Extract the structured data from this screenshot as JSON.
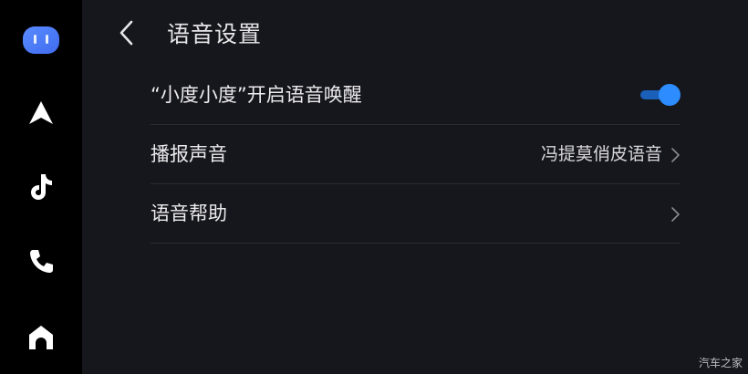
{
  "header": {
    "title": "语音设置"
  },
  "dock": {
    "items": [
      {
        "icon": "assistant-icon"
      },
      {
        "icon": "navigation-icon"
      },
      {
        "icon": "music-icon"
      },
      {
        "icon": "phone-icon"
      },
      {
        "icon": "home-icon"
      }
    ]
  },
  "settings": {
    "wake": {
      "label": "“小度小度”开启语音唤醒",
      "enabled": true
    },
    "broadcast": {
      "label": "播报声音",
      "value": "冯提莫俏皮语音"
    },
    "help": {
      "label": "语音帮助"
    }
  },
  "watermark": "汽车之家",
  "colors": {
    "accent": "#2d8cff",
    "background": "#16161d",
    "dock": "#000000"
  }
}
